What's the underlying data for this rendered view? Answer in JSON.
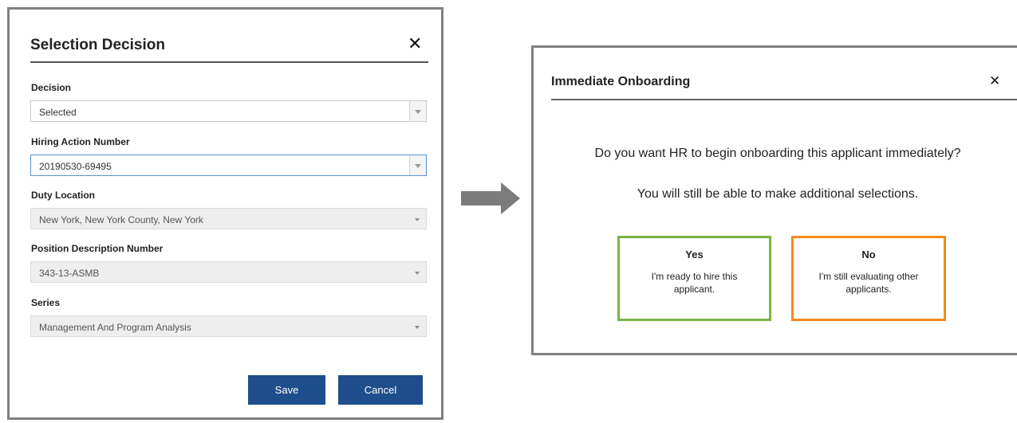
{
  "selection_dialog": {
    "title": "Selection Decision",
    "close_glyph": "✕",
    "fields": [
      {
        "label": "Decision",
        "value": "Selected"
      },
      {
        "label": "Hiring Action Number",
        "value": "20190530-69495"
      },
      {
        "label": "Duty Location",
        "value": "New York, New York County, New York"
      },
      {
        "label": "Position Description Number",
        "value": "343-13-ASMB"
      },
      {
        "label": "Series",
        "value": "Management And Program Analysis"
      }
    ],
    "save_label": "Save",
    "cancel_label": "Cancel"
  },
  "onboarding_dialog": {
    "title": "Immediate Onboarding",
    "close_glyph": "✕",
    "question": "Do you want HR to begin onboarding this applicant immediately?",
    "note": "You will still be able to make additional selections.",
    "yes": {
      "label": "Yes",
      "description": "I'm ready to hire this applicant."
    },
    "no": {
      "label": "No",
      "description": "I'm still evaluating other applicants."
    }
  },
  "colors": {
    "button_blue": "#1f4e8c",
    "yes_border": "#7cb342",
    "no_border": "#f08c1a",
    "focus_border": "#5b8fd6",
    "arrow_gray": "#7b7b7b"
  },
  "icons": {
    "close": "close-icon",
    "dropdown": "chevron-down-icon",
    "flow_arrow": "arrow-right-icon"
  }
}
